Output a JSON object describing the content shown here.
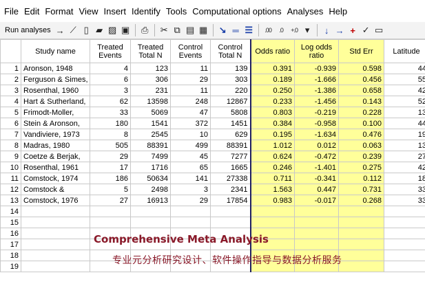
{
  "menu": [
    "File",
    "Edit",
    "Format",
    "View",
    "Insert",
    "Identify",
    "Tools",
    "Computational options",
    "Analyses",
    "Help"
  ],
  "toolbar": {
    "run_label": "Run analyses",
    "icons": [
      {
        "name": "run-arrow-icon",
        "glyph": "→",
        "cls": ""
      },
      {
        "name": "wand-icon",
        "glyph": "⟋",
        "cls": ""
      },
      {
        "name": "new-document-icon",
        "glyph": "▯",
        "cls": ""
      },
      {
        "name": "open-folder-icon",
        "glyph": "▰",
        "cls": ""
      },
      {
        "name": "import-icon",
        "glyph": "▨",
        "cls": ""
      },
      {
        "name": "save-icon",
        "glyph": "▣",
        "cls": ""
      },
      {
        "name": "sep"
      },
      {
        "name": "print-icon",
        "glyph": "⎙",
        "cls": ""
      },
      {
        "name": "sep"
      },
      {
        "name": "cut-icon",
        "glyph": "✂",
        "cls": ""
      },
      {
        "name": "copy-icon",
        "glyph": "⧉",
        "cls": ""
      },
      {
        "name": "paste-icon",
        "glyph": "▤",
        "cls": ""
      },
      {
        "name": "paste-special-icon",
        "glyph": "▦",
        "cls": ""
      },
      {
        "name": "sep"
      },
      {
        "name": "indent-icon",
        "glyph": "↘",
        "cls": "blue"
      },
      {
        "name": "outdent-icon",
        "glyph": "═",
        "cls": "blue"
      },
      {
        "name": "list-icon",
        "glyph": "☰",
        "cls": "blue"
      },
      {
        "name": "sep"
      },
      {
        "name": "decrease-decimals-icon",
        "glyph": ".00",
        "cls": "sm"
      },
      {
        "name": "increase-decimals-icon",
        "glyph": ".0",
        "cls": "sm"
      },
      {
        "name": "decimals-icon",
        "glyph": "+.0",
        "cls": "sm"
      },
      {
        "name": "dropdown-icon",
        "glyph": "▾",
        "cls": ""
      },
      {
        "name": "sep"
      },
      {
        "name": "arrow-down-icon",
        "glyph": "↓",
        "cls": "blue"
      },
      {
        "name": "arrow-right-icon",
        "glyph": "→",
        "cls": "blue"
      },
      {
        "name": "plus-icon",
        "glyph": "+",
        "cls": "red"
      },
      {
        "name": "checkmark-icon",
        "glyph": "✓",
        "cls": ""
      },
      {
        "name": "filter-icon",
        "glyph": "▭",
        "cls": ""
      }
    ]
  },
  "columns": [
    "Study name",
    "Treated Events",
    "Treated Total N",
    "Control Events",
    "Control Total N",
    "Odds ratio",
    "Log odds ratio",
    "Std Err",
    "Latitude"
  ],
  "rows": [
    {
      "n": "1",
      "study": "Aronson, 1948",
      "te": "4",
      "tn": "123",
      "ce": "11",
      "cn": "139",
      "or": "0.391",
      "lor": "-0.939",
      "se": "0.598",
      "lat": "44"
    },
    {
      "n": "2",
      "study": "Ferguson & Simes,",
      "te": "6",
      "tn": "306",
      "ce": "29",
      "cn": "303",
      "or": "0.189",
      "lor": "-1.666",
      "se": "0.456",
      "lat": "55"
    },
    {
      "n": "3",
      "study": "Rosenthal, 1960",
      "te": "3",
      "tn": "231",
      "ce": "11",
      "cn": "220",
      "or": "0.250",
      "lor": "-1.386",
      "se": "0.658",
      "lat": "42"
    },
    {
      "n": "4",
      "study": "Hart & Sutherland,",
      "te": "62",
      "tn": "13598",
      "ce": "248",
      "cn": "12867",
      "or": "0.233",
      "lor": "-1.456",
      "se": "0.143",
      "lat": "52"
    },
    {
      "n": "5",
      "study": "Frimodt-Moller,",
      "te": "33",
      "tn": "5069",
      "ce": "47",
      "cn": "5808",
      "or": "0.803",
      "lor": "-0.219",
      "se": "0.228",
      "lat": "13"
    },
    {
      "n": "6",
      "study": "Stein & Aronson,",
      "te": "180",
      "tn": "1541",
      "ce": "372",
      "cn": "1451",
      "or": "0.384",
      "lor": "-0.958",
      "se": "0.100",
      "lat": "44"
    },
    {
      "n": "7",
      "study": "Vandiviere, 1973",
      "te": "8",
      "tn": "2545",
      "ce": "10",
      "cn": "629",
      "or": "0.195",
      "lor": "-1.634",
      "se": "0.476",
      "lat": "19"
    },
    {
      "n": "8",
      "study": "Madras, 1980",
      "te": "505",
      "tn": "88391",
      "ce": "499",
      "cn": "88391",
      "or": "1.012",
      "lor": "0.012",
      "se": "0.063",
      "lat": "13"
    },
    {
      "n": "9",
      "study": "Coetze & Berjak,",
      "te": "29",
      "tn": "7499",
      "ce": "45",
      "cn": "7277",
      "or": "0.624",
      "lor": "-0.472",
      "se": "0.239",
      "lat": "27"
    },
    {
      "n": "10",
      "study": "Rosenthal, 1961",
      "te": "17",
      "tn": "1716",
      "ce": "65",
      "cn": "1665",
      "or": "0.246",
      "lor": "-1.401",
      "se": "0.275",
      "lat": "42"
    },
    {
      "n": "11",
      "study": "Comstock, 1974",
      "te": "186",
      "tn": "50634",
      "ce": "141",
      "cn": "27338",
      "or": "0.711",
      "lor": "-0.341",
      "se": "0.112",
      "lat": "18"
    },
    {
      "n": "12",
      "study": "Comstock &",
      "te": "5",
      "tn": "2498",
      "ce": "3",
      "cn": "2341",
      "or": "1.563",
      "lor": "0.447",
      "se": "0.731",
      "lat": "33"
    },
    {
      "n": "13",
      "study": "Comstock, 1976",
      "te": "27",
      "tn": "16913",
      "ce": "29",
      "cn": "17854",
      "or": "0.983",
      "lor": "-0.017",
      "se": "0.268",
      "lat": "33"
    }
  ],
  "empty_rows": [
    "14",
    "15",
    "16",
    "17",
    "18",
    "19"
  ],
  "watermark": {
    "title": "Comprehensive Meta Analysis",
    "subtitle": "专业元分析研究设计、软件操作指导与数据分析服务"
  },
  "colors": {
    "highlight": "#ffff9a",
    "watermark": "#8a1a2a"
  }
}
